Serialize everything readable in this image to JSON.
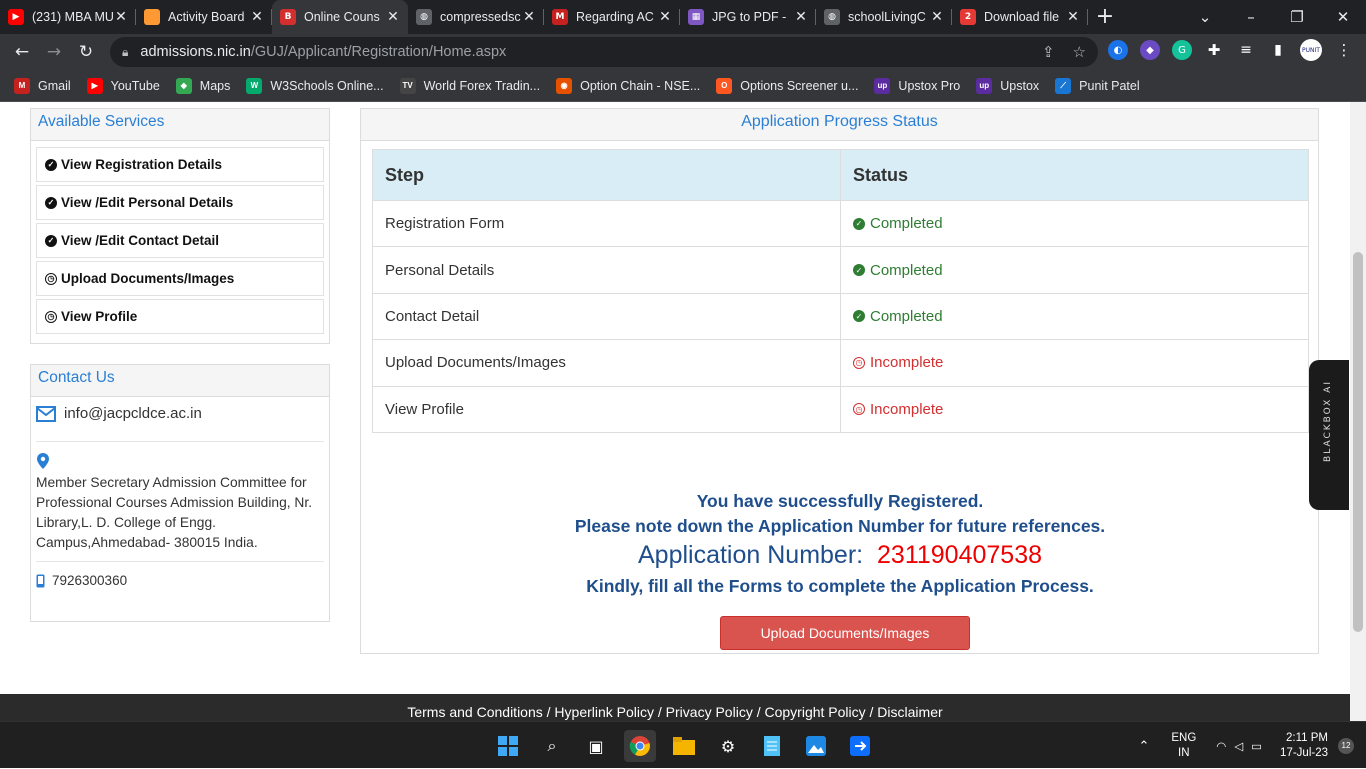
{
  "tabs": [
    {
      "title": "(231) MBA MU",
      "fav_color": "#ff0000",
      "fav_glyph": "▶"
    },
    {
      "title": "Activity Board",
      "fav_color": "#ff9933",
      "fav_glyph": ""
    },
    {
      "title": "Online Couns",
      "fav_color": "#d32f2f",
      "fav_glyph": "B",
      "active": true
    },
    {
      "title": "compressedsc",
      "fav_color": "#5f6368",
      "fav_glyph": "◍"
    },
    {
      "title": "Regarding AC",
      "fav_color": "#c5221f",
      "fav_glyph": "M"
    },
    {
      "title": "JPG to PDF -",
      "fav_color": "#7e57c2",
      "fav_glyph": "▦"
    },
    {
      "title": "schoolLivingC",
      "fav_color": "#5f6368",
      "fav_glyph": "◍"
    },
    {
      "title": "Download file",
      "fav_color": "#e53935",
      "fav_glyph": "2"
    }
  ],
  "url": {
    "host": "admissions.nic.in",
    "path": "/GUJ/Applicant/Registration/Home.aspx"
  },
  "bookmarks": [
    {
      "label": "Gmail",
      "color": "#c5221f",
      "glyph": "M"
    },
    {
      "label": "YouTube",
      "color": "#ff0000",
      "glyph": "▶"
    },
    {
      "label": "Maps",
      "color": "#34a853",
      "glyph": "◆"
    },
    {
      "label": "W3Schools Online...",
      "color": "#04aa6d",
      "glyph": "W"
    },
    {
      "label": "World Forex Tradin...",
      "color": "#444",
      "glyph": "TV"
    },
    {
      "label": "Option Chain - NSE...",
      "color": "#e65100",
      "glyph": "◉"
    },
    {
      "label": "Options Screener u...",
      "color": "#ff5722",
      "glyph": "O"
    },
    {
      "label": "Upstox Pro",
      "color": "#5a2ca0",
      "glyph": "up"
    },
    {
      "label": "Upstox",
      "color": "#5a2ca0",
      "glyph": "up"
    },
    {
      "label": "Punit Patel",
      "color": "#1976d2",
      "glyph": "⟋"
    }
  ],
  "services": {
    "title": "Available Services",
    "items": [
      {
        "label": "View Registration Details",
        "done": true
      },
      {
        "label": "View /Edit Personal Details",
        "done": true
      },
      {
        "label": "View /Edit Contact Detail",
        "done": true
      },
      {
        "label": "Upload Documents/Images",
        "done": false
      },
      {
        "label": "View Profile",
        "done": false
      }
    ]
  },
  "contact": {
    "title": "Contact Us",
    "email": "info@jacpcldce.ac.in",
    "address": "Member Secretary Admission Committee for Professional Courses Admission Building, Nr. Library,L. D. College of Engg. Campus,Ahmedabad- 380015 India.",
    "phone": "7926300360"
  },
  "progress": {
    "title": "Application Progress Status",
    "col_step": "Step",
    "col_status": "Status",
    "rows": [
      {
        "step": "Registration Form",
        "status": "Completed",
        "ok": true
      },
      {
        "step": "Personal Details",
        "status": "Completed",
        "ok": true
      },
      {
        "step": "Contact Detail",
        "status": "Completed",
        "ok": true
      },
      {
        "step": "Upload Documents/Images",
        "status": "Incomplete",
        "ok": false
      },
      {
        "step": "View Profile",
        "status": "Incomplete",
        "ok": false
      }
    ]
  },
  "message": {
    "line1": "You have successfully Registered.",
    "line2": "Please note down the Application Number for future references.",
    "app_label": "Application Number:",
    "app_number": "231190407538",
    "line4": "Kindly, fill all the Forms to complete the Application Process.",
    "button": "Upload Documents/Images"
  },
  "footer": "Terms and Conditions  /  Hyperlink Policy  /  Privacy Policy  /  Copyright Policy  /  Disclaimer",
  "sidebar_widget": "BLACKBOX AI",
  "profile_badge": "PUNIT",
  "taskbar": {
    "lang": "ENG",
    "region": "IN",
    "time": "2:11 PM",
    "date": "17-Jul-23",
    "notif": "12"
  },
  "colors": {
    "accent_blue": "#2a7fd4",
    "ok_green": "#2e7d32",
    "error_red": "#d32f2f",
    "button_red": "#d9534f"
  }
}
